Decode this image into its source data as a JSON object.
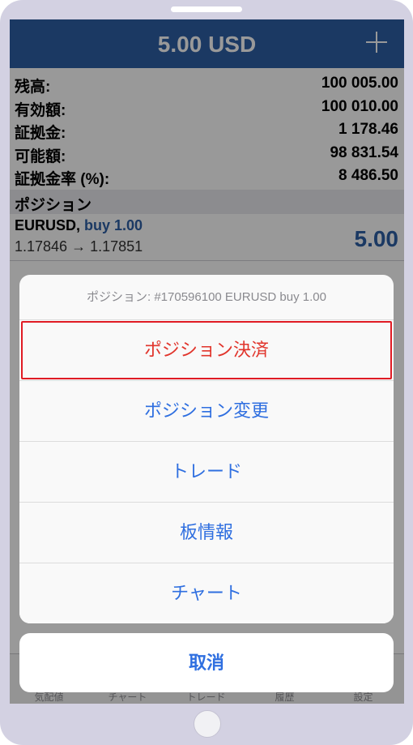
{
  "navbar": {
    "title": "5.00 USD",
    "add_icon": "plus-icon"
  },
  "account": {
    "rows": [
      {
        "label": "残高:",
        "value": "100 005.00"
      },
      {
        "label": "有効額:",
        "value": "100 010.00"
      },
      {
        "label": "証拠金:",
        "value": "1 178.46"
      },
      {
        "label": "可能額:",
        "value": "98 831.54"
      },
      {
        "label": "証拠金率 (%):",
        "value": "8 486.50"
      }
    ]
  },
  "positions": {
    "header": "ポジション",
    "item": {
      "symbol": "EURUSD,",
      "side": "buy 1.00",
      "prices": "1.17846 → 1.17851",
      "profit": "5.00"
    }
  },
  "tabbar": {
    "tabs": [
      "気配値",
      "チャート",
      "トレード",
      "履歴",
      "設定"
    ]
  },
  "action_sheet": {
    "title": "ポジション: #170596100 EURUSD buy 1.00",
    "buttons": [
      "ポジション決済",
      "ポジション変更",
      "トレード",
      "板情報",
      "チャート"
    ],
    "cancel": "取消"
  },
  "colors": {
    "nav_blue": "#2e5fa6",
    "action_blue": "#2f6fe0",
    "destructive_red": "#e1352c",
    "highlight_red": "#e01b24"
  }
}
